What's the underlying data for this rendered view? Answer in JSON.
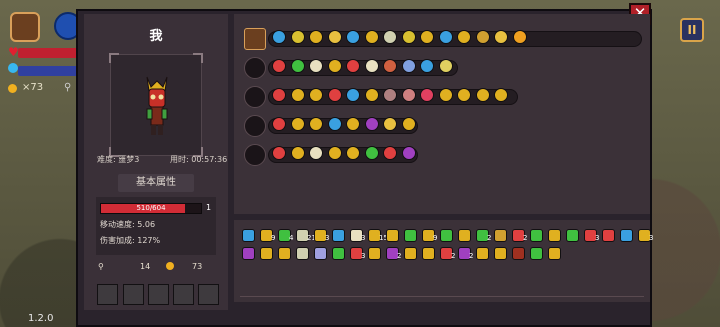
{
  "hud": {
    "coins": "73",
    "version": "1.2.0",
    "pause_icon": "pause-icon",
    "colors": {
      "hp": "#c02030",
      "mp": "#3040a0"
    }
  },
  "close_label": "✕",
  "character": {
    "name": "我",
    "difficulty": "难度: 噩梦3",
    "time": "用时: 00:57:36",
    "attr_tab": "基本属性",
    "hp_text": "510/604",
    "hp_fraction": 0.844,
    "level": "1",
    "move_speed": "移动速度: 5.06",
    "damage_bonus": "伤害加成: 127%",
    "keys": "14",
    "gold": "73"
  },
  "equipment_rows": [
    {
      "lead": "chest-icon",
      "count": 14,
      "colors": [
        "#3aa0e0",
        "#d8c030",
        "#e0b020",
        "#e8c040",
        "#3aa0e0",
        "#e0b020",
        "#d0d0b0",
        "#d8c030",
        "#e0b020",
        "#3aa0e0",
        "#e0b020",
        "#d0a030",
        "#e8c040",
        "#f0a020"
      ]
    },
    {
      "lead": "sword-icon",
      "count": 10,
      "colors": [
        "#e04040",
        "#40c040",
        "#e8e0c0",
        "#e0b020",
        "#e04040",
        "#e8e0c0",
        "#d06040",
        "#80a0e0",
        "#3aa0e0",
        "#e0d060"
      ]
    },
    {
      "lead": "staff-icon",
      "count": 13,
      "colors": [
        "#e04040",
        "#e0b020",
        "#e0b020",
        "#e04040",
        "#3aa0e0",
        "#e0b020",
        "#b08080",
        "#d08080",
        "#e04060",
        "#e0b020",
        "#e0b020",
        "#e0b020",
        "#e0b020"
      ]
    },
    {
      "lead": "spear-icon",
      "count": 8,
      "colors": [
        "#e04040",
        "#e0b020",
        "#e0b020",
        "#3aa0e0",
        "#e0b020",
        "#a040c0",
        "#e8c040",
        "#e0b020"
      ]
    },
    {
      "lead": "axe-icon",
      "count": 8,
      "colors": [
        "#e04040",
        "#e0b020",
        "#e8e0c0",
        "#e0b020",
        "#e0b020",
        "#40c040",
        "#e04040",
        "#a040c0"
      ]
    }
  ],
  "inventory": {
    "row1": [
      {
        "c": "#3aa0e0",
        "n": ""
      },
      {
        "c": "#e0b020",
        "n": "9"
      },
      {
        "c": "#40c040",
        "n": "4"
      },
      {
        "c": "#d0d0b0",
        "n": "21"
      },
      {
        "c": "#e0b020",
        "n": "3"
      },
      {
        "c": "#3aa0e0",
        "n": ""
      },
      {
        "c": "#e8e0c0",
        "n": "3"
      },
      {
        "c": "#e0b020",
        "n": "15"
      },
      {
        "c": "#e0b020",
        "n": ""
      },
      {
        "c": "#40c040",
        "n": ""
      },
      {
        "c": "#e0b020",
        "n": "9"
      },
      {
        "c": "#40c040",
        "n": ""
      },
      {
        "c": "#e0b020",
        "n": ""
      },
      {
        "c": "#40c040",
        "n": "2"
      },
      {
        "c": "#d0a030",
        "n": ""
      },
      {
        "c": "#e04040",
        "n": "2"
      },
      {
        "c": "#40c040",
        "n": ""
      },
      {
        "c": "#e0b020",
        "n": ""
      },
      {
        "c": "#40c040",
        "n": ""
      },
      {
        "c": "#e04040",
        "n": "3"
      },
      {
        "c": "#e04040",
        "n": ""
      },
      {
        "c": "#3aa0e0",
        "n": ""
      },
      {
        "c": "#e0b020",
        "n": "3"
      }
    ],
    "row2": [
      {
        "c": "#a040c0",
        "n": ""
      },
      {
        "c": "#e0b020",
        "n": ""
      },
      {
        "c": "#e0b020",
        "n": ""
      },
      {
        "c": "#d0d0b0",
        "n": ""
      },
      {
        "c": "#a0a0e0",
        "n": ""
      },
      {
        "c": "#40c040",
        "n": ""
      },
      {
        "c": "#e04040",
        "n": "3"
      },
      {
        "c": "#e0b020",
        "n": ""
      },
      {
        "c": "#a040c0",
        "n": "2"
      },
      {
        "c": "#e0b020",
        "n": ""
      },
      {
        "c": "#e0b020",
        "n": ""
      },
      {
        "c": "#e04040",
        "n": "2"
      },
      {
        "c": "#a040c0",
        "n": "2"
      },
      {
        "c": "#e0b020",
        "n": ""
      },
      {
        "c": "#e0b020",
        "n": ""
      },
      {
        "c": "#a03020",
        "n": ""
      },
      {
        "c": "#40c040",
        "n": ""
      },
      {
        "c": "#e0b020",
        "n": ""
      }
    ]
  }
}
